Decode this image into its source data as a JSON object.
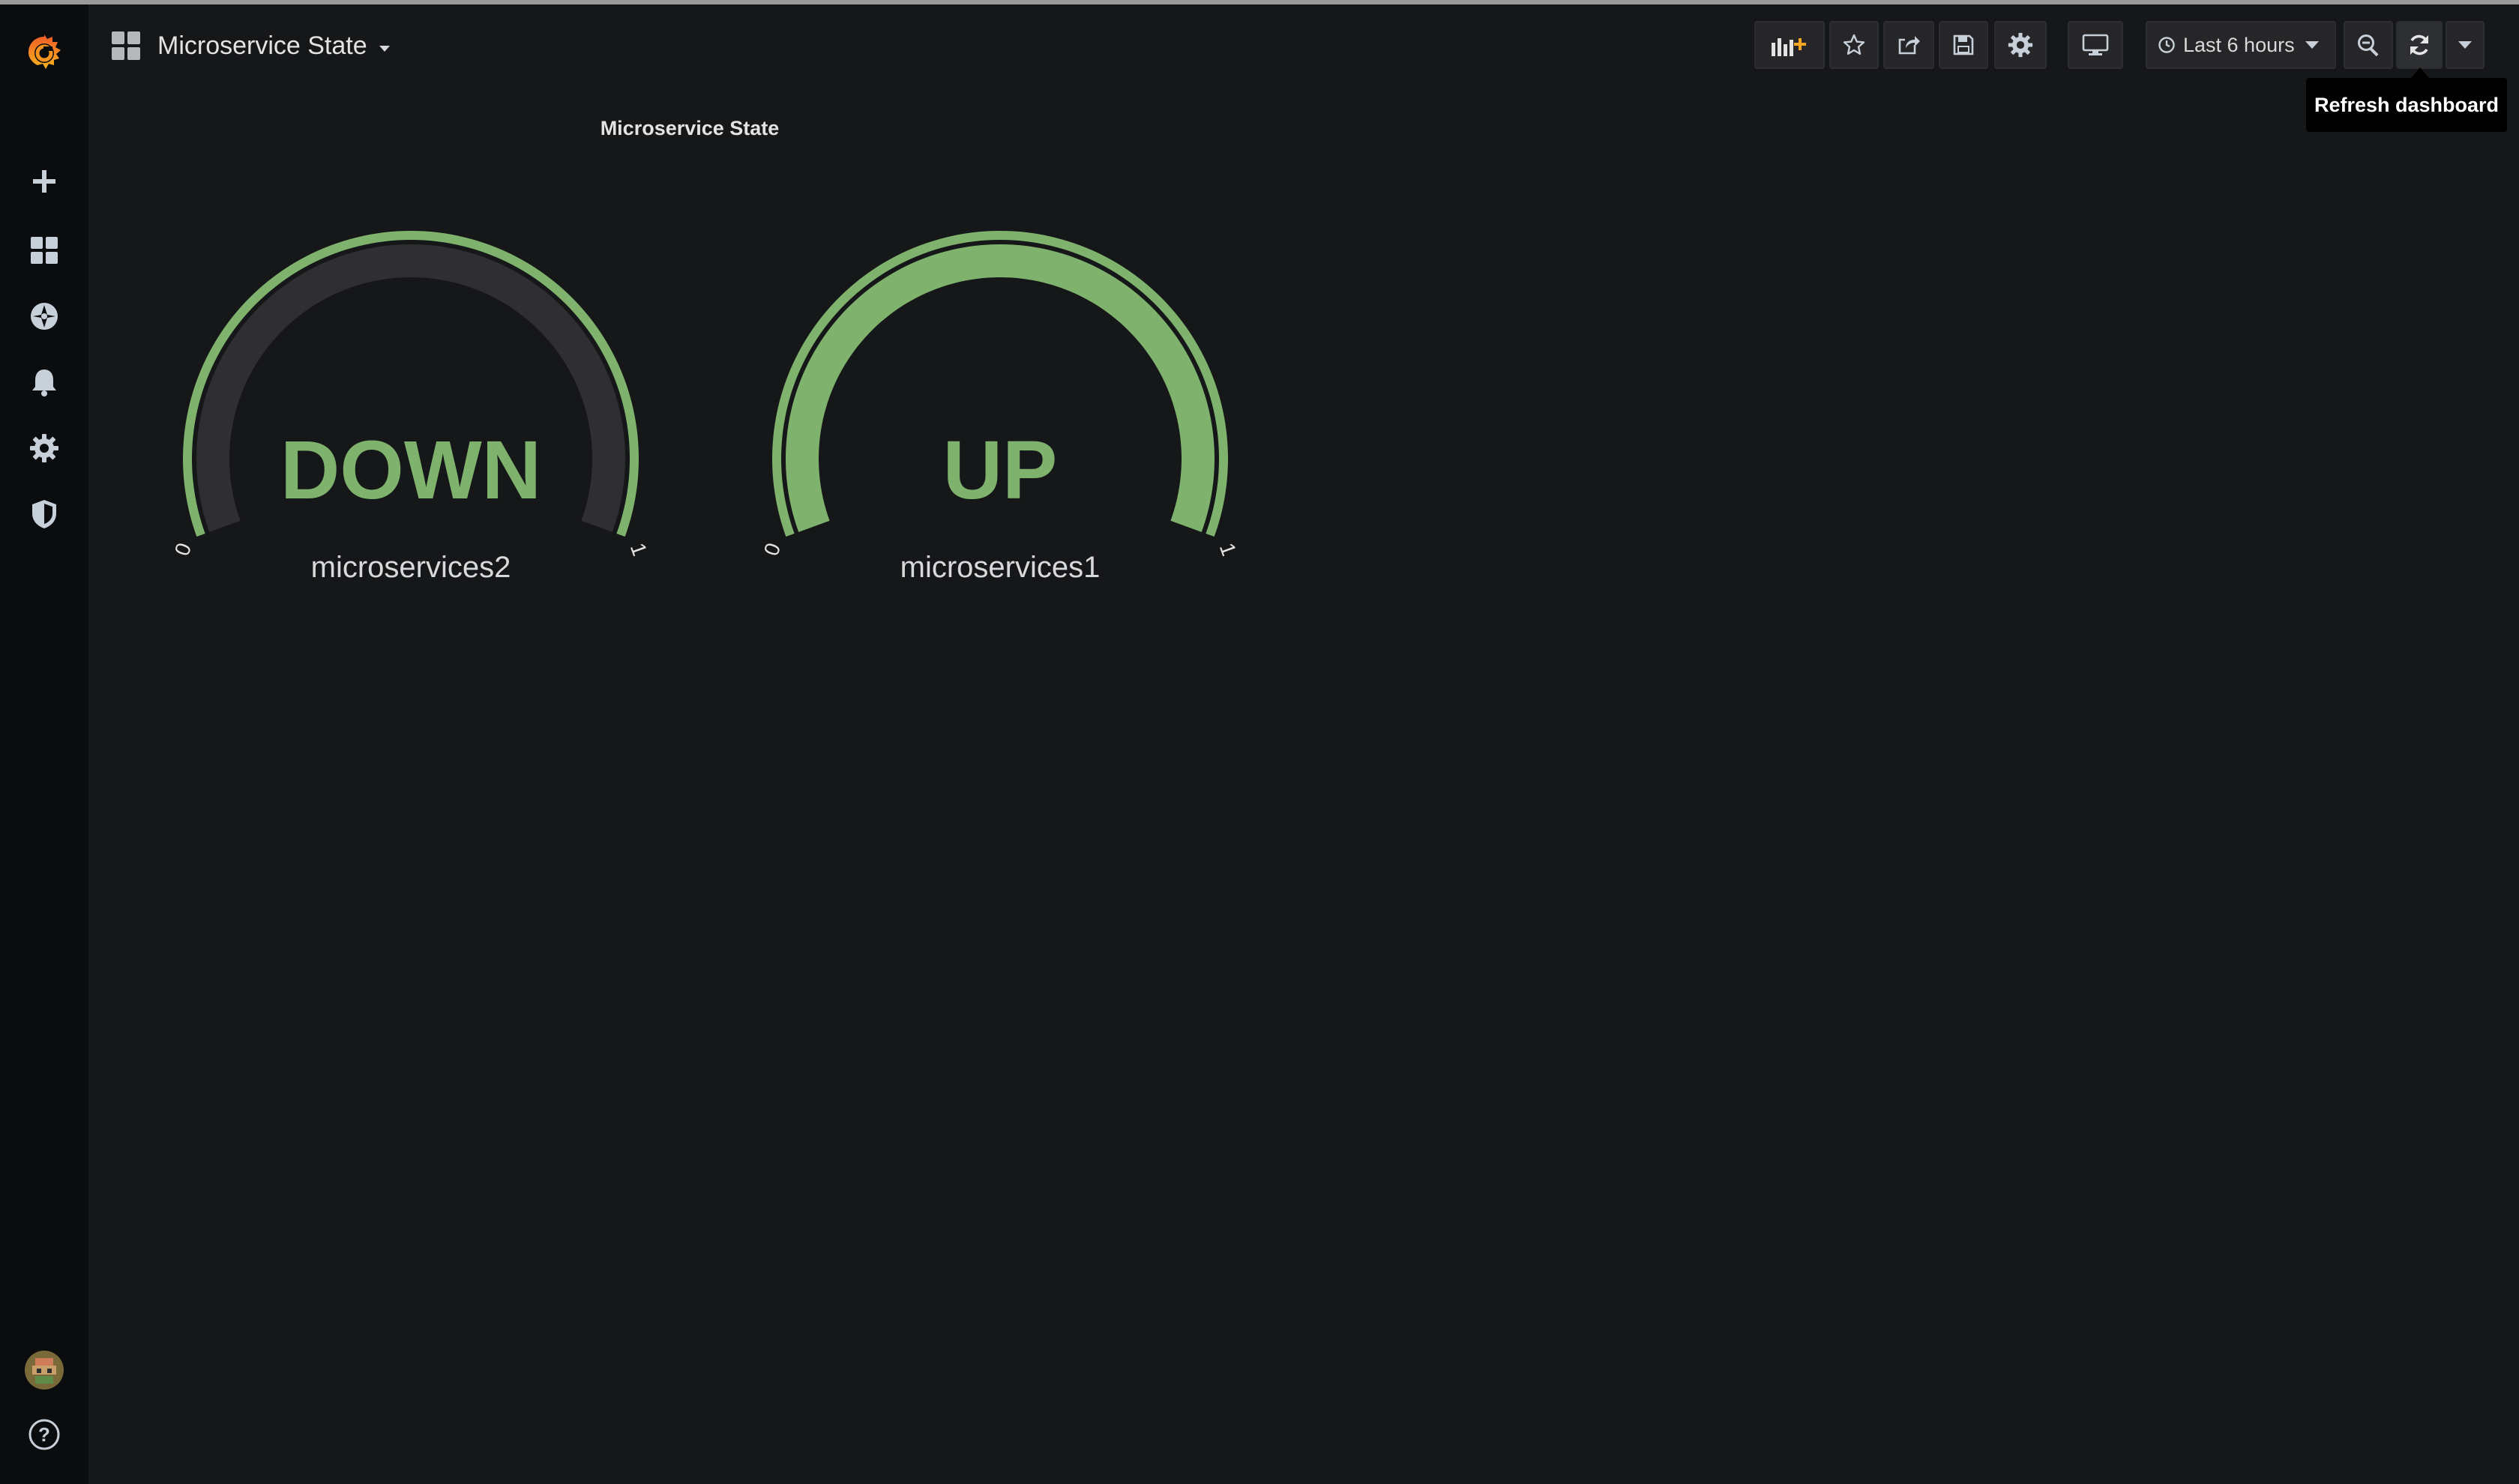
{
  "dashboard": {
    "title": "Microservice State"
  },
  "sidebar": {
    "items": [
      {
        "name": "grafana-logo-icon"
      },
      {
        "name": "plus-icon",
        "label": "Create"
      },
      {
        "name": "dashboards-icon",
        "label": "Dashboards"
      },
      {
        "name": "explore-icon",
        "label": "Explore"
      },
      {
        "name": "alerting-bell-icon",
        "label": "Alerting"
      },
      {
        "name": "gear-icon",
        "label": "Configuration"
      },
      {
        "name": "shield-icon",
        "label": "Server Admin"
      },
      {
        "name": "avatar",
        "label": "User"
      },
      {
        "name": "help-icon",
        "label": "Help"
      }
    ]
  },
  "toolbar": {
    "time_range_label": "Last 6 hours",
    "tooltip": "Refresh dashboard",
    "icons": [
      "add-panel-icon",
      "star-icon",
      "share-icon",
      "save-icon",
      "settings-gear-icon",
      "tv-mode-icon",
      "clock-icon",
      "zoom-out-icon",
      "refresh-icon",
      "chevron-down-icon"
    ]
  },
  "panel": {
    "title": "Microservice State",
    "gauges": [
      {
        "series": "microservices2",
        "value_text": "DOWN",
        "value": 0,
        "min": "0",
        "max": "1",
        "min_value": 0,
        "max_value": 1
      },
      {
        "series": "microservices1",
        "value_text": "UP",
        "value": 1,
        "min": "0",
        "max": "1",
        "min_value": 0,
        "max_value": 1
      }
    ]
  },
  "colors": {
    "background": "#161719",
    "sidebar": "#0b0c0e",
    "gauge_green": "#7eb26d",
    "gauge_track": "#2f2f32",
    "text": "#d8d9da",
    "accent_orange": "#f05a28"
  }
}
